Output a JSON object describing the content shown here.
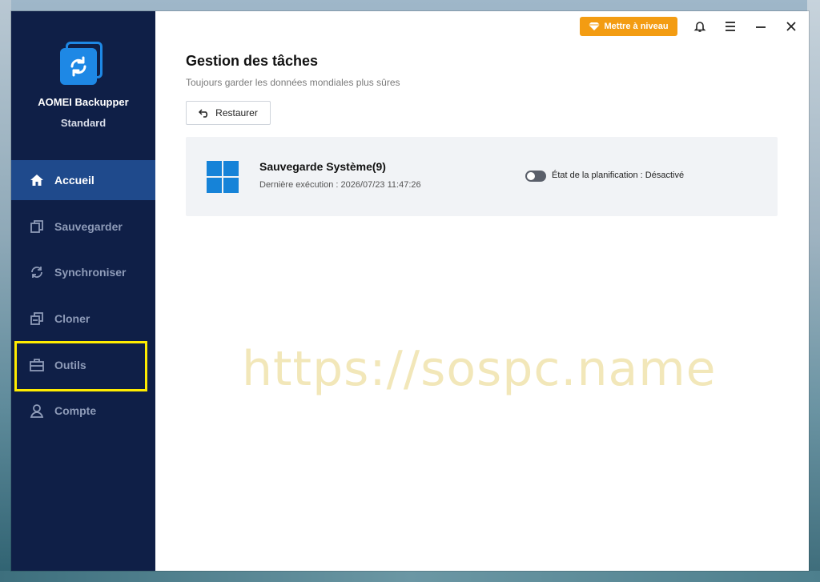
{
  "app": {
    "name": "AOMEI Backupper",
    "edition": "Standard"
  },
  "sidebar": {
    "items": [
      {
        "label": "Accueil",
        "icon": "home-icon",
        "active": true
      },
      {
        "label": "Sauvegarder",
        "icon": "backup-icon"
      },
      {
        "label": "Synchroniser",
        "icon": "sync-icon"
      },
      {
        "label": "Cloner",
        "icon": "clone-icon"
      },
      {
        "label": "Outils",
        "icon": "toolbox-icon"
      },
      {
        "label": "Compte",
        "icon": "user-icon"
      }
    ]
  },
  "header": {
    "upgrade_label": "Mettre à niveau",
    "icons": [
      "bell-icon",
      "menu-icon",
      "minimize-icon",
      "close-icon"
    ]
  },
  "main": {
    "title": "Gestion des tâches",
    "subtitle": "Toujours garder les données mondiales plus sûres",
    "restore_label": "Restaurer",
    "task": {
      "name": "Sauvegarde Système(9)",
      "last_run": "Dernière exécution : 2026/07/23 11:47:26",
      "schedule_state": "État de la planification : Désactivé",
      "schedule_enabled": false
    }
  },
  "watermark": "https://sospc.name",
  "colors": {
    "sidebar_bg": "#0f1f47",
    "active_item": "#1f4a8c",
    "upgrade": "#f39c12",
    "highlight": "#ffec00",
    "brand_blue": "#1e88e5"
  }
}
